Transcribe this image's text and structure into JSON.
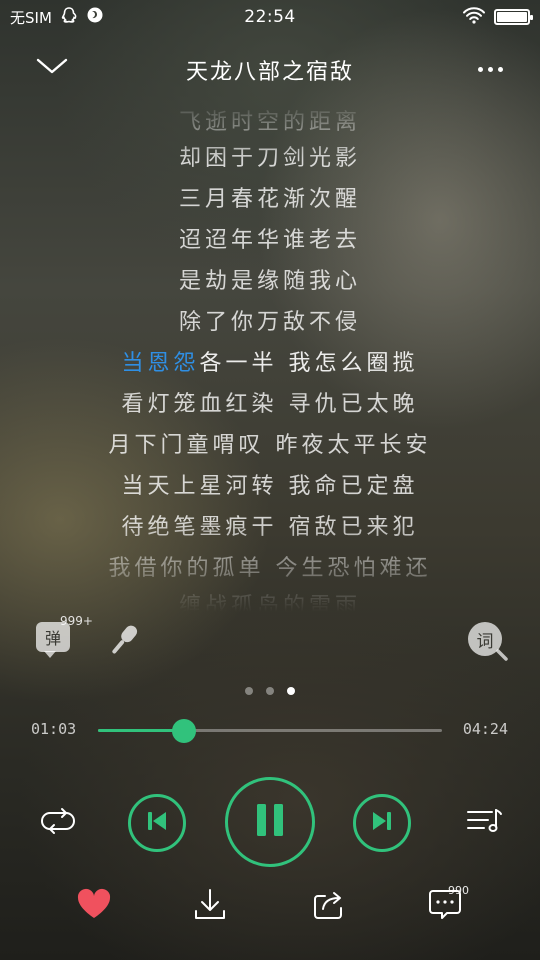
{
  "status_bar": {
    "carrier": "无SIM",
    "time": "22:54",
    "battery_level": 1.0,
    "icons": [
      "qq-icon",
      "notification-icon",
      "wifi-icon",
      "battery-icon"
    ]
  },
  "header": {
    "title": "天龙八部之宿敌",
    "back_icon": "chevron-down-icon",
    "more_icon": "more-dots-icon"
  },
  "lyrics": {
    "lines": [
      "飞逝时空的距离",
      "却困于刀剑光影",
      "三月春花渐次醒",
      "迢迢年华谁老去",
      "是劫是缘随我心",
      "除了你万敌不侵",
      "当恩怨各一半 我怎么圈揽",
      "看灯笼血红染 寻仇已太晚",
      "月下门童喟叹 昨夜太平长安",
      "当天上星河转 我命已定盘",
      "待绝笔墨痕干 宿敌已来犯",
      "我借你的孤单 今生恐怕难还",
      "缠战孤岛的雷雨"
    ],
    "current_index": 6,
    "current_highlight": "当恩怨",
    "current_rest": "各一半 我怎么圈揽"
  },
  "tools": {
    "danmu_label": "弹",
    "danmu_count": "999+",
    "lyric_label": "词"
  },
  "pager": {
    "count": 3,
    "active": 2
  },
  "progress": {
    "current": "01:03",
    "total": "04:24",
    "fraction": 0.25
  },
  "controls": {
    "repeat_icon": "repeat-icon",
    "prev_icon": "previous-icon",
    "play_icon": "pause-icon",
    "next_icon": "next-icon",
    "playlist_icon": "playlist-icon"
  },
  "bottom": {
    "comment_count": "990",
    "fav_icon": "heart-icon",
    "download_icon": "download-icon",
    "share_icon": "share-icon",
    "comment_icon": "comment-icon"
  },
  "colors": {
    "accent": "#31c27c",
    "lyric_highlight": "#2f8fe4",
    "favorite": "#f0515e"
  }
}
